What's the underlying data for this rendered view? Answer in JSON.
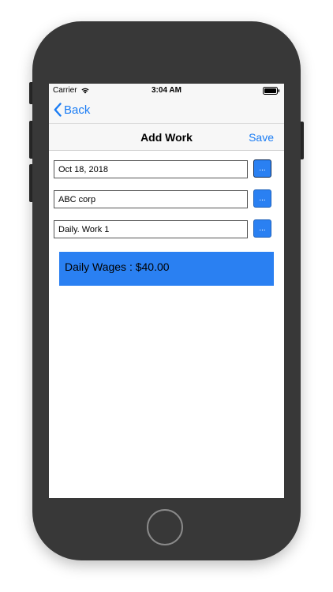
{
  "status_bar": {
    "carrier": "Carrier",
    "time": "3:04 AM"
  },
  "nav": {
    "back_label": "Back",
    "title": "Add Work",
    "save_label": "Save"
  },
  "form": {
    "date_value": "Oct 18, 2018",
    "company_value": "ABC corp",
    "work_value": "Daily. Work 1",
    "picker_label": "..."
  },
  "wages": {
    "text": "Daily Wages : $40.00"
  },
  "colors": {
    "accent": "#1a7cf4",
    "button_fill": "#2a80f2",
    "device_body": "#383838",
    "nav_background": "#f7f7f7"
  },
  "icons": {
    "wifi": "wifi-icon",
    "battery": "battery-icon",
    "back": "chevron-left-icon"
  }
}
